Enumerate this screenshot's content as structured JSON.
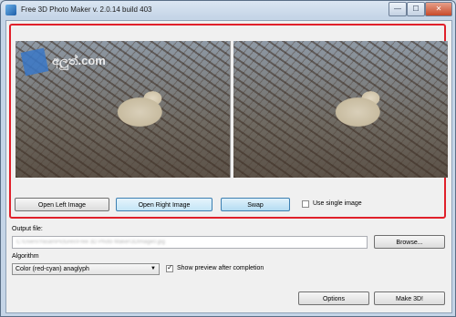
{
  "window": {
    "title": "Free 3D Photo Maker  v. 2.0.14 build 403"
  },
  "titlebar": {
    "minimize": "—",
    "maximize": "☐",
    "close": "✕"
  },
  "preview": {
    "logo_text": "අලුත්.com"
  },
  "buttons": {
    "open_left": "Open Left Image",
    "open_right": "Open Right Image",
    "swap": "Swap",
    "browse": "Browse...",
    "options": "Options",
    "make3d": "Make 3D!"
  },
  "single_image": {
    "label": "Use single image",
    "checked": false
  },
  "output": {
    "label": "Output file:",
    "value": "C:\\Users\\Yasan\\Pictures\\Free 3D Photo Maker\\3DImage0.jpg"
  },
  "algorithm": {
    "label": "Algorithm",
    "selected": "Color (red-cyan) anaglyph"
  },
  "show_preview": {
    "label": "Show preview after completion",
    "checked": true
  }
}
